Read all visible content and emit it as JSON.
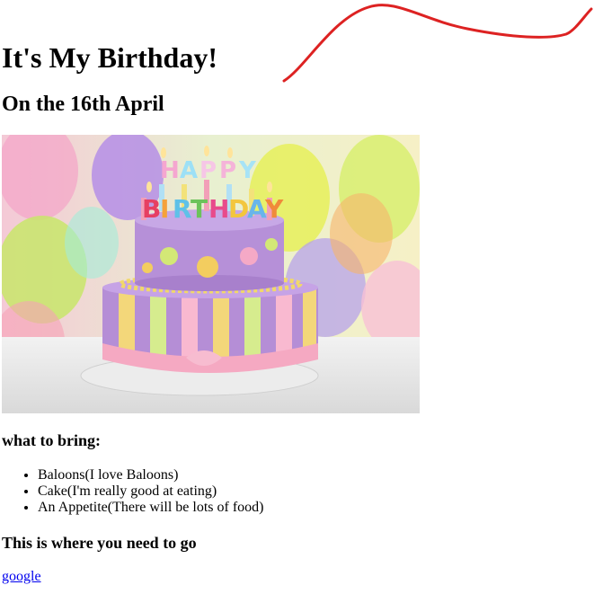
{
  "page": {
    "title": "It's My Birthday!",
    "subtitle": "On the 16th April",
    "image": {
      "alt": "birthday cake with happy birthday candles"
    },
    "bring_heading": "what to bring:",
    "bring_items": [
      "Baloons(I love Baloons)",
      "Cake(I'm really good at eating)",
      "An Appetite(There will be lots of food)"
    ],
    "go_heading": "This is where you need to go",
    "link_text": "google",
    "colors": {
      "link": "#0000ee",
      "scribble": "#dd2222"
    }
  }
}
